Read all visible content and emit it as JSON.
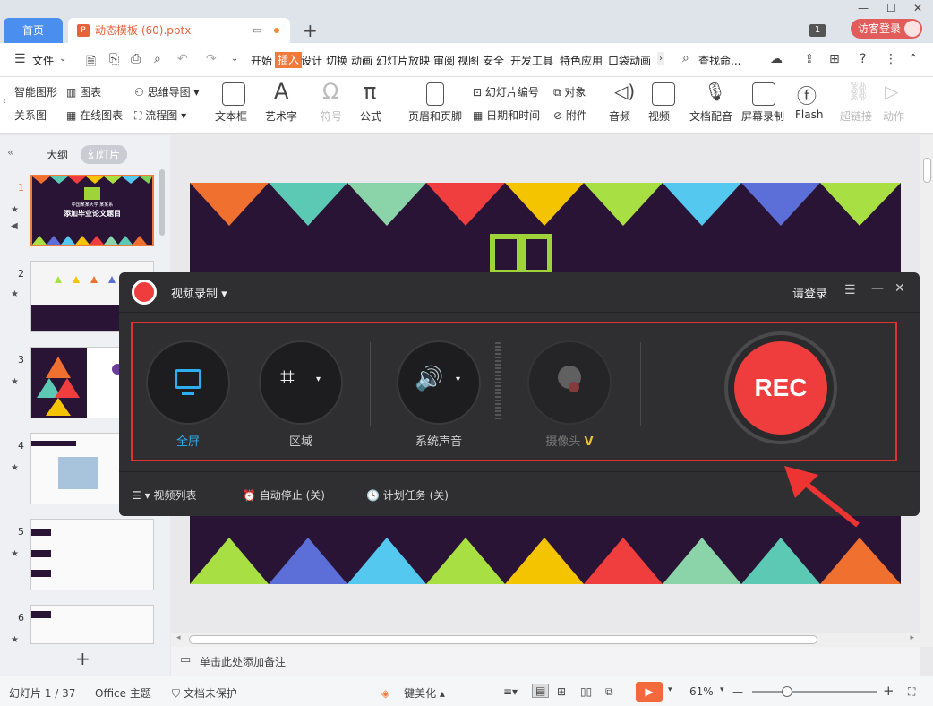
{
  "tabs": {
    "home": "首页",
    "doc_name": "动态模板 (60).pptx",
    "badge": "1",
    "login": "访客登录"
  },
  "menu": {
    "file": "文件",
    "items": [
      "开始",
      "插入",
      "设计",
      "切换",
      "动画",
      "幻灯片放映",
      "审阅",
      "视图",
      "安全",
      "开发工具",
      "特色应用",
      "口袋动画"
    ],
    "search": "查找命..."
  },
  "ribbon": {
    "smart_shape": "智能图形",
    "chart": "图表",
    "mindmap": "思维导图",
    "relation": "关系图",
    "online_chart": "在线图表",
    "flowchart": "流程图",
    "textbox": "文本框",
    "wordart": "艺术字",
    "symbol": "符号",
    "formula": "公式",
    "header_footer": "页眉和页脚",
    "slide_number": "幻灯片编号",
    "object": "对象",
    "datetime": "日期和时间",
    "attachment": "附件",
    "audio": "音频",
    "video": "视频",
    "doc_dub": "文档配音",
    "screen_rec": "屏幕录制",
    "flash": "Flash",
    "hyperlink": "超链接",
    "action": "动作"
  },
  "leftpanel": {
    "outline": "大纲",
    "slides": "幻灯片",
    "numbers": [
      "1",
      "2",
      "3",
      "4",
      "5",
      "6"
    ]
  },
  "slide1_thumb": {
    "line1": "中国某某大学 某某系",
    "line2": "添加毕业论文题目"
  },
  "recorder": {
    "title": "视频录制",
    "login": "请登录",
    "fullscreen": "全屏",
    "region": "区域",
    "system_audio": "系统声音",
    "camera": "摄像头",
    "rec": "REC",
    "video_list": "视频列表",
    "auto_stop": "自动停止 (关)",
    "schedule": "计划任务 (关)"
  },
  "notes": "单击此处添加备注",
  "status": {
    "slide_counter": "幻灯片 1 / 37",
    "theme": "Office 主题",
    "protect": "文档未保护",
    "beautify": "一键美化",
    "zoom": "61%"
  },
  "colors": {
    "accent": "#ef7a3c",
    "rec_red": "#ef3d3d",
    "highlight_box": "#e03232",
    "fullscreen_blue": "#2eaef0",
    "slide_bg": "#2a1436"
  }
}
